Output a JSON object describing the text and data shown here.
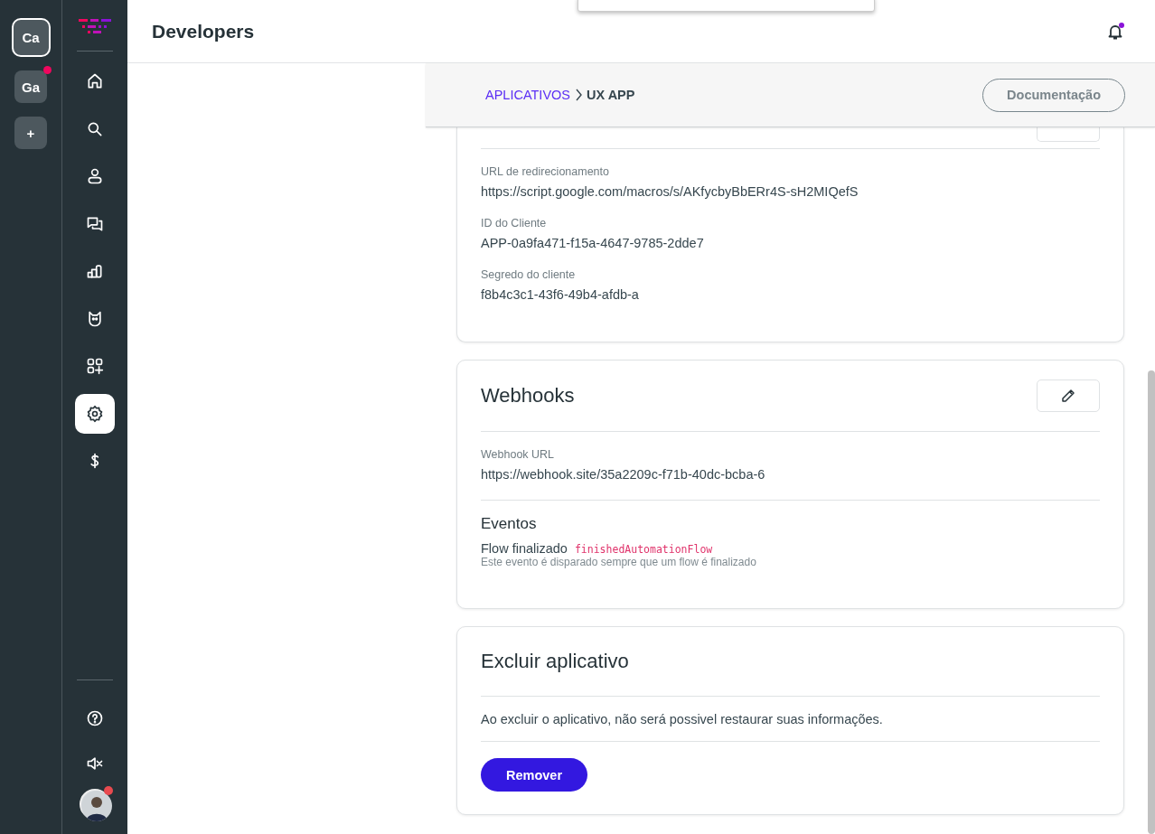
{
  "workspaces": [
    {
      "label": "Ca",
      "selected": true,
      "notification": false
    },
    {
      "label": "Ga",
      "selected": false,
      "notification": true
    },
    {
      "label": "+",
      "selected": false,
      "notification": false
    }
  ],
  "nav": {
    "items": [
      {
        "kind": "home",
        "selected": false
      },
      {
        "kind": "search",
        "selected": false
      },
      {
        "kind": "person",
        "selected": false
      },
      {
        "kind": "chat",
        "selected": false
      },
      {
        "kind": "chart",
        "selected": false
      },
      {
        "kind": "bot",
        "selected": false
      },
      {
        "kind": "apps",
        "selected": false
      },
      {
        "kind": "settings",
        "selected": true
      },
      {
        "kind": "dollar",
        "selected": false
      }
    ],
    "bottom_items": [
      {
        "kind": "help"
      },
      {
        "kind": "mute"
      },
      {
        "kind": "avatar",
        "notification": true
      }
    ]
  },
  "header": {
    "title": "Developers",
    "notification": true
  },
  "breadcrumb": {
    "items": [
      {
        "label": "APLICATIVOS",
        "kind": "link"
      },
      {
        "label": "UX APP",
        "kind": "current"
      }
    ],
    "button": "Documentação"
  },
  "cards": [
    {
      "kind": "fields",
      "fields": [
        {
          "label": "URL de redirecionamento",
          "value": "https://script.google.com/macros/s/AKfycbyBbERr4S-sH2MIQefS"
        },
        {
          "label": "ID do Cliente",
          "value": "APP-0a9fa471-f15a-4647-9785-2dde7"
        },
        {
          "label": "Segredo do cliente",
          "value": "f8b4c3c1-43f6-49b4-afdb-a"
        }
      ]
    },
    {
      "kind": "webhook",
      "title": "Webhooks",
      "fields": [
        {
          "label": "Webhook URL",
          "value": "https://webhook.site/35a2209c-f71b-40dc-bcba-6"
        }
      ],
      "events": {
        "title": "Eventos",
        "items": [
          {
            "name": "Flow finalizado",
            "code": "finishedAutomationFlow",
            "description": "Este evento é disparado sempre que um flow é finalizado"
          }
        ]
      }
    },
    {
      "kind": "danger",
      "title": "Excluir aplicativo",
      "text": "Ao excluir o aplicativo, não será possivel restaurar suas informações.",
      "button": "Remover"
    }
  ]
}
